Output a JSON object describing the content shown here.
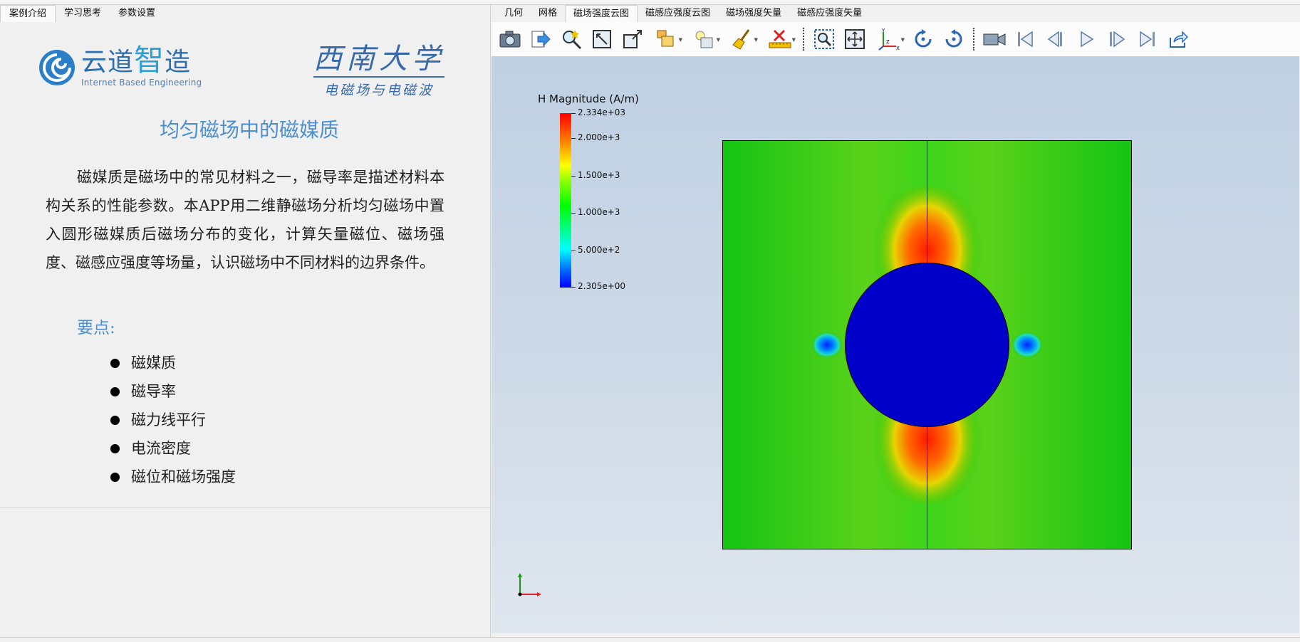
{
  "left_tabs": [
    {
      "label": "案例介绍",
      "active": true
    },
    {
      "label": "学习思考",
      "active": false
    },
    {
      "label": "参数设置",
      "active": false
    }
  ],
  "logo_yundao": {
    "name_a": "云道",
    "name_b": "智",
    "name_c": "造",
    "subtitle": "Internet Based Engineering"
  },
  "logo_swu": {
    "name": "西南大学",
    "course": "电磁场与电磁波"
  },
  "intro": {
    "title": "均匀磁场中的磁媒质",
    "paragraph": "磁媒质是磁场中的常见材料之一，磁导率是描述材料本构关系的性能参数。本APP用二维静磁场分析均匀磁场中置入圆形磁媒质后磁场分布的变化，计算矢量磁位、磁场强度、磁感应强度等场量，认识磁场中不同材料的边界条件。",
    "key_points_heading": "要点:",
    "key_points": [
      "磁媒质",
      "磁导率",
      "磁力线平行",
      "电流密度",
      "磁位和磁场强度"
    ]
  },
  "right_tabs": [
    {
      "label": "几何",
      "active": false
    },
    {
      "label": "网格",
      "active": false
    },
    {
      "label": "磁场强度云图",
      "active": true
    },
    {
      "label": "磁感应强度云图",
      "active": false
    },
    {
      "label": "磁场强度矢量",
      "active": false
    },
    {
      "label": "磁感应强度矢量",
      "active": false
    }
  ],
  "toolbar": [
    "camera-icon",
    "export-icon",
    "zoom-select-icon",
    "fit-view-icon",
    "reset-view-icon",
    "box-display-icon",
    "light-display-icon",
    "clear-brush-icon",
    "ruler-delete-icon",
    "zoom-box-icon",
    "pan-icon",
    "axes-icon",
    "rotate-cw-icon",
    "rotate-ccw-icon",
    "video-camera-icon",
    "first-frame-icon",
    "prev-frame-icon",
    "play-icon",
    "next-frame-icon",
    "last-frame-icon",
    "share-icon"
  ],
  "legend": {
    "title": "H Magnitude (A/m)",
    "max_label": "2.334e+03",
    "labels": [
      "2.000e+3",
      "1.500e+3",
      "1.000e+3",
      "5.000e+2"
    ],
    "min_label": "2.305e+00",
    "max_value": 2334,
    "min_value": 2.305,
    "label_values": [
      2000,
      1500,
      1000,
      500
    ]
  },
  "triad": {
    "x_label": "X",
    "y_label": "Y"
  },
  "colors": {
    "accent": "#4d8fd0",
    "inside_circle": "#0000c8",
    "field_green": "#10c010"
  }
}
